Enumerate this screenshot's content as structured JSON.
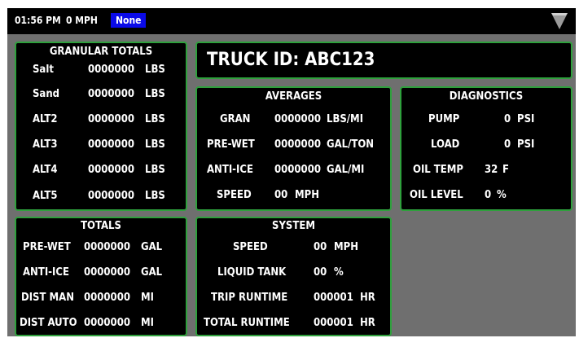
{
  "status_bar": {
    "time": "01:56 PM",
    "speed": "0 MPH",
    "mode": "None",
    "menu_icon": "signal-triangle-icon"
  },
  "colors": {
    "panel_border": "#2ea03c",
    "mode_badge": "#0a0ae8",
    "background": "#6f6f6f"
  },
  "granular_totals": {
    "title": "GRANULAR TOTALS",
    "rows": [
      {
        "label": "Salt",
        "value": "0000000",
        "unit": "LBS"
      },
      {
        "label": "Sand",
        "value": "0000000",
        "unit": "LBS"
      },
      {
        "label": "ALT2",
        "value": "0000000",
        "unit": "LBS"
      },
      {
        "label": "ALT3",
        "value": "0000000",
        "unit": "LBS"
      },
      {
        "label": "ALT4",
        "value": "0000000",
        "unit": "LBS"
      },
      {
        "label": "ALT5",
        "value": "0000000",
        "unit": "LBS"
      }
    ]
  },
  "truck": {
    "label": "TRUCK ID: ABC123"
  },
  "averages": {
    "title": "AVERAGES",
    "rows": [
      {
        "label": "GRAN",
        "value": "0000000",
        "unit": "LBS/MI"
      },
      {
        "label": "PRE-WET",
        "value": "0000000",
        "unit": "GAL/TON"
      },
      {
        "label": "ANTI-ICE",
        "value": "0000000",
        "unit": "GAL/MI"
      },
      {
        "label": "SPEED",
        "value": "00",
        "unit": "MPH"
      }
    ]
  },
  "diagnostics": {
    "title": "DIAGNOSTICS",
    "rows": [
      {
        "label": "PUMP",
        "value": "0",
        "unit": "PSI"
      },
      {
        "label": "LOAD",
        "value": "0",
        "unit": "PSI"
      },
      {
        "label": "OIL TEMP",
        "value": "32",
        "unit": "F"
      },
      {
        "label": "OIL LEVEL",
        "value": "0",
        "unit": "%"
      }
    ]
  },
  "totals": {
    "title": "TOTALS",
    "rows": [
      {
        "label": "PRE-WET",
        "value": "0000000",
        "unit": "GAL"
      },
      {
        "label": "ANTI-ICE",
        "value": "0000000",
        "unit": "GAL"
      },
      {
        "label": "DIST MAN",
        "value": "0000000",
        "unit": "MI"
      },
      {
        "label": "DIST AUTO",
        "value": "0000000",
        "unit": "MI"
      }
    ]
  },
  "system": {
    "title": "SYSTEM",
    "rows": [
      {
        "label": "SPEED",
        "value": "00",
        "unit": "MPH"
      },
      {
        "label": "LIQUID TANK",
        "value": "00",
        "unit": "%"
      },
      {
        "label": "TRIP RUNTIME",
        "value": "000001",
        "unit": "HR"
      },
      {
        "label": "TOTAL RUNTIME",
        "value": "000001",
        "unit": "HR"
      }
    ]
  }
}
